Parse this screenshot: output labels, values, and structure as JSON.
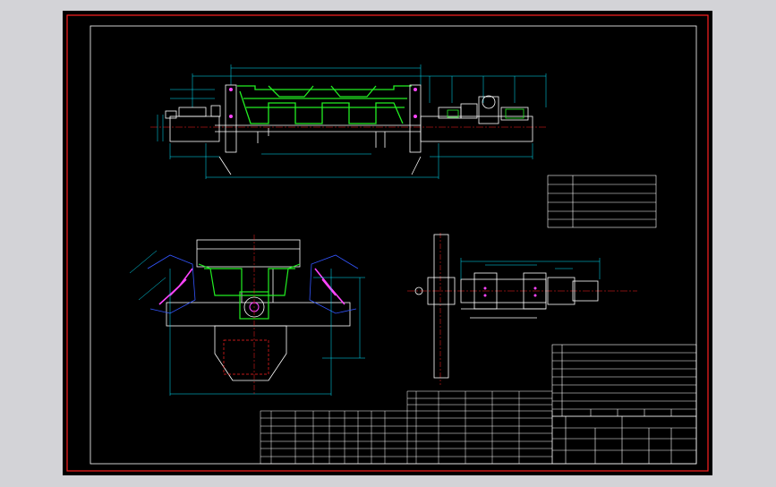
{
  "colors": {
    "background": "#d3d3d7",
    "sheet": "#000000",
    "border_outer": "#ff2020",
    "border_inner": "#ffffff",
    "structure": "#ffffff",
    "trough": "#22ee22",
    "dimension": "#00e5ff",
    "centerline": "#ff2020",
    "bolts": "#ff44ff",
    "frame_blue": "#3355ff"
  },
  "views": [
    {
      "id": "front-elevation"
    },
    {
      "id": "side-section"
    },
    {
      "id": "plan-view"
    }
  ],
  "tables": {
    "top_right_table_rows": 5,
    "parts_list_rows": 9,
    "lower_revision_grid_rows": 7
  }
}
